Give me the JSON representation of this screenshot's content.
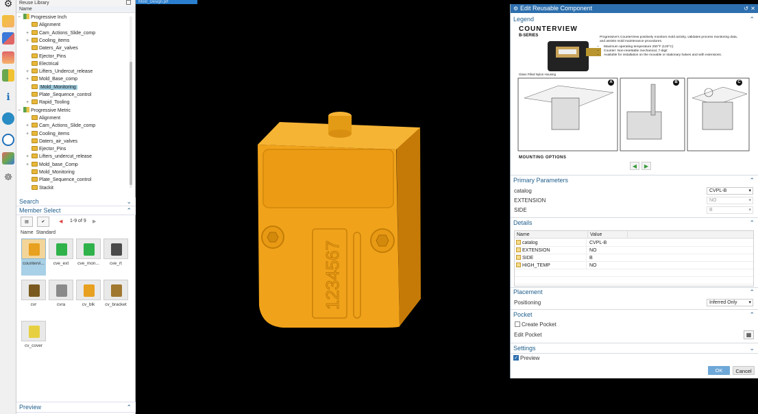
{
  "library": {
    "title": "Reuse Library",
    "name_header": "Name",
    "tree": [
      {
        "label": "Progressive Inch",
        "level": 0,
        "type": "lib",
        "expander": "−"
      },
      {
        "label": "Alignment",
        "level": 1,
        "type": "folder",
        "expander": ""
      },
      {
        "label": "Cam_Actions_Slide_comp",
        "level": 1,
        "type": "folder",
        "expander": "+"
      },
      {
        "label": "Cooling_items",
        "level": 1,
        "type": "folder",
        "expander": "+"
      },
      {
        "label": "Daters_Air_valves",
        "level": 1,
        "type": "folder",
        "expander": ""
      },
      {
        "label": "Ejector_Pins",
        "level": 1,
        "type": "folder",
        "expander": ""
      },
      {
        "label": "Electrical",
        "level": 1,
        "type": "folder",
        "expander": ""
      },
      {
        "label": "Lifters_Undercut_release",
        "level": 1,
        "type": "folder",
        "expander": "+"
      },
      {
        "label": "Mold_Base_comp",
        "level": 1,
        "type": "folder",
        "expander": "+"
      },
      {
        "label": "Mold_Monitoring",
        "level": 1,
        "type": "folder",
        "expander": "",
        "selected": true
      },
      {
        "label": "Plate_Sequence_control",
        "level": 1,
        "type": "folder",
        "expander": ""
      },
      {
        "label": "Rapid_Tooling",
        "level": 1,
        "type": "folder",
        "expander": "+"
      },
      {
        "label": "Progressive Metric",
        "level": 0,
        "type": "lib",
        "expander": "−"
      },
      {
        "label": "Alignment",
        "level": 1,
        "type": "folder",
        "expander": ""
      },
      {
        "label": "Cam_Actions_Slide_comp",
        "level": 1,
        "type": "folder",
        "expander": "+"
      },
      {
        "label": "Cooling_items",
        "level": 1,
        "type": "folder",
        "expander": "+"
      },
      {
        "label": "Daters_air_valves",
        "level": 1,
        "type": "folder",
        "expander": ""
      },
      {
        "label": "Ejector_Pins",
        "level": 1,
        "type": "folder",
        "expander": ""
      },
      {
        "label": "Lifters_undercut_release",
        "level": 1,
        "type": "folder",
        "expander": "+"
      },
      {
        "label": "Mold_base_Comp",
        "level": 1,
        "type": "folder",
        "expander": "+"
      },
      {
        "label": "Mold_Monitoring",
        "level": 1,
        "type": "folder",
        "expander": ""
      },
      {
        "label": "Plate_Sequence_control",
        "level": 1,
        "type": "folder",
        "expander": ""
      },
      {
        "label": "Stackit",
        "level": 1,
        "type": "folder",
        "expander": ""
      }
    ],
    "search_label": "Search",
    "member_select_label": "Member Select",
    "page_info": "1-9 of 9",
    "grid_head_name": "Name",
    "grid_head_standard": "Standard",
    "members": [
      {
        "label": "countervi...",
        "color": "#e8a020",
        "selected": true
      },
      {
        "label": "cve_ext",
        "color": "#2fb24a"
      },
      {
        "label": "cve_mon...",
        "color": "#2fb24a"
      },
      {
        "label": "cve_rt",
        "color": "#4b4b4b"
      },
      {
        "label": "cvr",
        "color": "#7a5a20"
      },
      {
        "label": "cvra",
        "color": "#8a8a8a"
      },
      {
        "label": "cv_blk",
        "color": "#e8a020"
      },
      {
        "label": "cv_bracket",
        "color": "#a07830"
      },
      {
        "label": "cv_cover",
        "color": "#e6d040"
      }
    ],
    "preview_label": "Preview"
  },
  "viewport": {
    "tab_label": "Mold_Design.prt",
    "part_number_text": "1234567",
    "part_color": "#f0a21a"
  },
  "dialog": {
    "title": "Edit Reusable Component",
    "legend_label": "Legend",
    "legend_brand": "COUNTERVIEW",
    "legend_series": "B-SERIES",
    "legend_desc": "Progressive's CounterView positively monitors mold activity, validates process monitoring data, and assists mold maintenance procedures.",
    "legend_bullets": [
      "Maximum operating temperature 250°F (120°C)",
      "Counter: Non-resettable mechanical, 7-digit",
      "Available for installation on the movable or stationary halves and with extensions."
    ],
    "legend_note": "Glass Filled Nylon Housing",
    "legend_panels": [
      "A",
      "B",
      "C"
    ],
    "mounting_options": "MOUNTING OPTIONS",
    "primary_label": "Primary Parameters",
    "params": [
      {
        "label": "catalog",
        "value": "CVPL-B",
        "disabled": false
      },
      {
        "label": "EXTENSION",
        "value": "NO",
        "disabled": true
      },
      {
        "label": "SIDE",
        "value": "B",
        "disabled": true
      }
    ],
    "details_label": "Details",
    "details_cols": [
      "Name",
      "Value"
    ],
    "details_rows": [
      {
        "name": "catalog",
        "value": "CVPL-B"
      },
      {
        "name": "EXTENSION",
        "value": "NO"
      },
      {
        "name": "SIDE",
        "value": "B"
      },
      {
        "name": "HIGH_TEMP",
        "value": "NO"
      }
    ],
    "placement_label": "Placement",
    "positioning_label": "Positioning",
    "positioning_value": "Inferred Only",
    "pocket_label": "Pocket",
    "create_pocket_label": "Create Pocket",
    "edit_pocket_label": "Edit Pocket",
    "settings_label": "Settings",
    "preview_label": "Preview",
    "ok_label": "OK",
    "cancel_label": "Cancel"
  }
}
